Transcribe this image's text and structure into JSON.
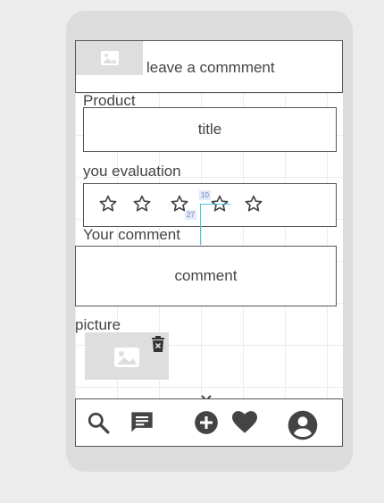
{
  "header": {
    "title": "leave a commment",
    "image_icon": "image-icon"
  },
  "product": {
    "section_label": "Product",
    "title_field": "title"
  },
  "evaluation": {
    "section_label": "you evaluation",
    "rating": 0,
    "max_rating": 5,
    "star_icon": "star-outline-icon"
  },
  "comment": {
    "section_label": "Your comment",
    "field": "comment"
  },
  "picture": {
    "section_label": "picture",
    "image_icon": "image-icon",
    "delete_icon": "delete-icon"
  },
  "guides": {
    "vertical_value": "10",
    "horizontal_value": "27"
  },
  "bottom_nav": {
    "items": [
      {
        "icon": "search-icon"
      },
      {
        "icon": "chat-icon"
      },
      {
        "icon": "add-circle-icon"
      },
      {
        "icon": "heart-icon"
      },
      {
        "icon": "account-icon"
      }
    ]
  },
  "colors": {
    "icon": "#444444",
    "placeholder": "#dedede",
    "guide": "#48c9d8",
    "frame": "#dcdcdc"
  }
}
